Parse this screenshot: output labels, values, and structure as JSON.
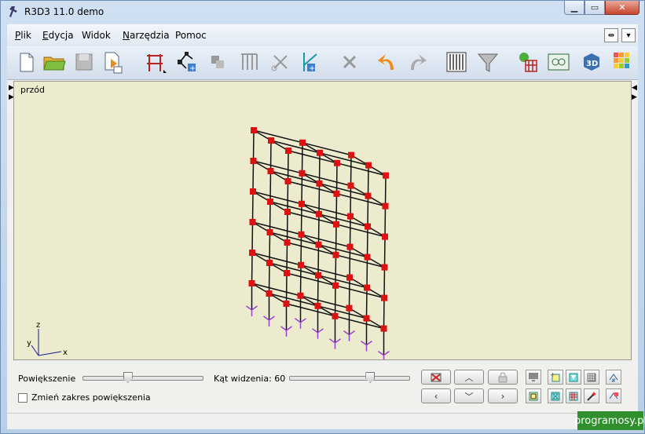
{
  "window": {
    "title": "R3D3 11.0 demo"
  },
  "menu": [
    "Plik",
    "Edycja",
    "Widok",
    "Narzędzia",
    "Pomoc"
  ],
  "menu_underline": [
    "P",
    "E",
    "",
    "N",
    ""
  ],
  "toolbar": [
    "new-file-icon",
    "open-folder-icon",
    "save-disk-icon",
    "export-icon",
    "frame-icon",
    "node-add-icon",
    "blocks-icon",
    "columns-icon",
    "scissors-icon",
    "axes-add-icon",
    "delete-x-icon",
    "undo-icon",
    "redo-icon",
    "grid-icon",
    "filter-funnel-icon",
    "calculate-gear-icon",
    "results-image-icon",
    "view-3d-icon",
    "color-map-icon"
  ],
  "viewport": {
    "label": "przód",
    "axes": {
      "x": "x",
      "y": "y",
      "z": "z"
    }
  },
  "controls": {
    "zoom_label": "Powiększenie",
    "angle_label": "Kąt widzenia: 60",
    "zoom_range_label": "Zmień zakres powiększenia",
    "zoom_range_checked": false,
    "zoom_level": 0.38,
    "angle_level": 0.68
  },
  "watermark": "programosy.pl"
}
